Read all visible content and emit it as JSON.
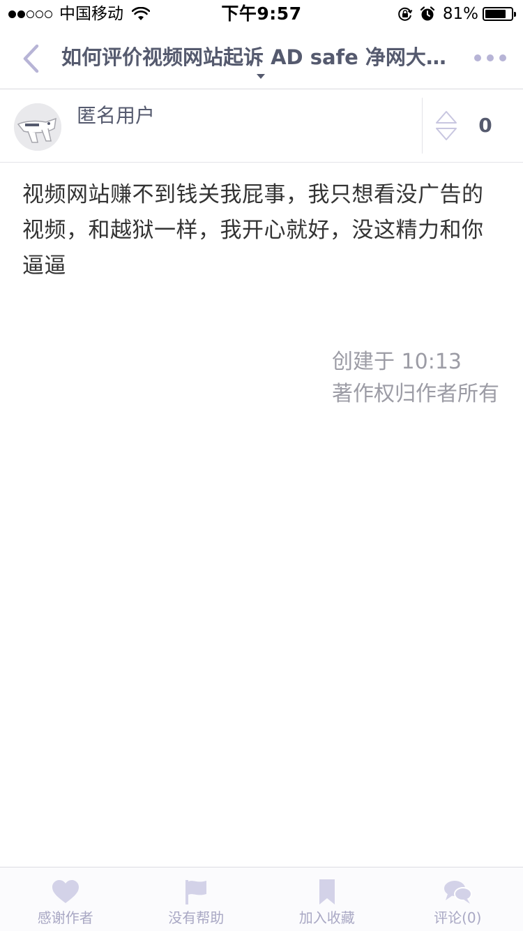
{
  "status_bar": {
    "carrier": "中国移动",
    "time": "下午9:57",
    "battery_percent": "81%",
    "battery_level": 0.81,
    "signal_strength": 2
  },
  "nav": {
    "title": "如何评价视频网站起诉 AD safe 净网大师？",
    "accent_color": "#b7b4d6"
  },
  "author": {
    "name": "匿名用户",
    "vote_count": "0"
  },
  "answer": {
    "text": "视频网站赚不到钱关我屁事，我只想看没广告的视频，和越狱一样，我开心就好，没这精力和你逼逼",
    "created": "创建于 10:13",
    "copyright": "著作权归作者所有"
  },
  "tab_bar": {
    "items": [
      {
        "label": "感谢作者",
        "icon": "heart-icon"
      },
      {
        "label": "没有帮助",
        "icon": "flag-icon"
      },
      {
        "label": "加入收藏",
        "icon": "bookmark-icon"
      },
      {
        "label": "评论(0)",
        "icon": "comment-icon"
      }
    ]
  }
}
